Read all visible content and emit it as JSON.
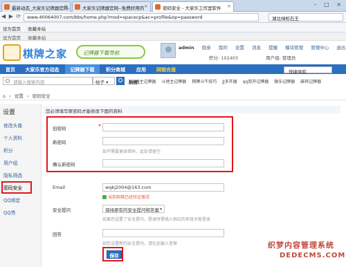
{
  "browser": {
    "tabs": [
      {
        "label": "最新动态_大家乐记牌器官网--免"
      },
      {
        "label": "大家乐记牌器官网--免费好用的"
      },
      {
        "label": "密码安全 - 大家乐工作室软件"
      }
    ],
    "url": "www.40064007.com/bbs/home.php?mod=spacecp&ac=profile&op=password",
    "search_text": "湖北绿松石王",
    "bookmarks": [
      "设为首页",
      "收藏本站"
    ]
  },
  "site": {
    "top_links": [
      "设为首页",
      "收藏本站"
    ],
    "brand": "棋牌之家",
    "slogan": "记牌器下载导航",
    "user": {
      "name": "admin",
      "links": [
        "隐身",
        "我的",
        "设置",
        "消息",
        "提醒",
        "模块管理",
        "管理中心",
        "退出"
      ],
      "points": "积分: 102403",
      "group": "用户组: 管理员"
    },
    "nav": [
      "首页",
      "大家乐官方动态",
      "记牌器下载",
      "积分商城",
      "应用",
      "网银充值"
    ],
    "quick_nav": "快捷导航",
    "search": {
      "placeholder": "请输入搜索内容",
      "type": "帖子",
      "hot_label": "热搜:",
      "hot_items": [
        "jj斗地主记牌器",
        "斗地主记牌器",
        "棋牌斗牛技巧",
        "JJ多开器",
        "qq双开记牌器",
        "微乐记牌器",
        "麻将记牌器"
      ]
    },
    "breadcrumb": [
      "设置",
      "密码安全"
    ]
  },
  "sidebar": {
    "title": "设置",
    "items": [
      "修改头像",
      "个人资料",
      "积分",
      "用户组",
      "隐私筛选",
      "密码安全",
      "QQ绑定",
      "QQ秀"
    ]
  },
  "form": {
    "notice": "您必须填写原密码才能修改下面的资料",
    "old_password_label": "旧密码",
    "required_mark": "*",
    "new_password_label": "新密码",
    "new_password_hint": "如不需要更改密码，此处请留空",
    "confirm_password_label": "确认新密码",
    "email_label": "Email",
    "email_value": "wqkj2004@163.com",
    "email_status": "当前邮箱已经验证激活",
    "security_question_label": "安全提问",
    "security_question_value": "保持原有的安全提问和答案",
    "security_question_hint": "如果您设置了安全提问，登录时需填入相应的项目才能登录",
    "answer_label": "回答",
    "answer_hint": "如您设置新的安全提问，请在此输入答案",
    "save_label": "保存"
  },
  "watermark": {
    "line1": "织梦内容管理系统",
    "line2": "DEDECMS.COM"
  },
  "colors": {
    "nav_blue": "#2a6fc0",
    "highlight_red": "#e0151a"
  }
}
